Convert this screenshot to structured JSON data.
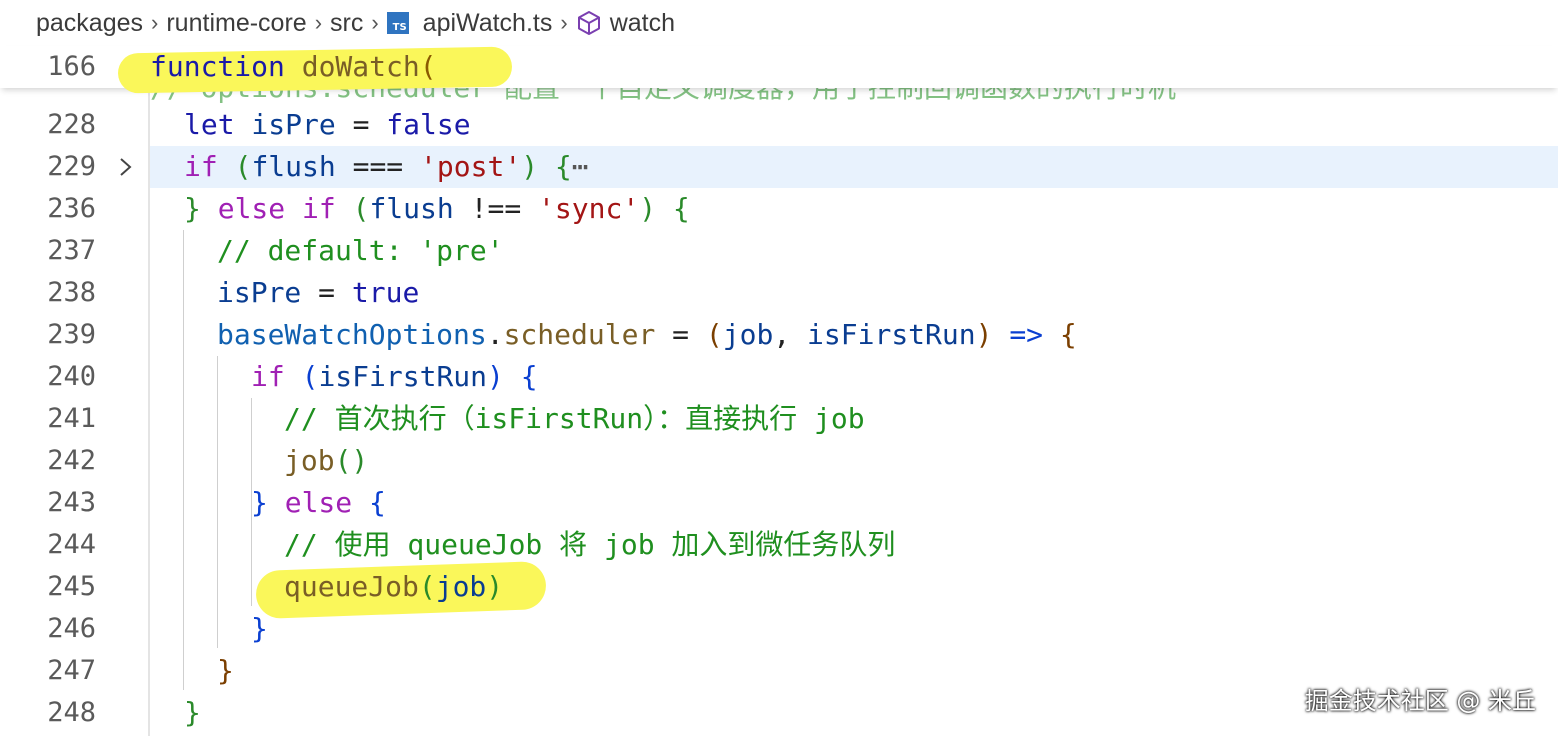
{
  "breadcrumb": {
    "items": [
      "packages",
      "runtime-core",
      "src",
      "apiWatch.ts",
      "watch"
    ],
    "file_icon_text": "TS"
  },
  "editor": {
    "sticky_line": {
      "number": "166",
      "text": "function doWatch("
    },
    "hidden_line_text": "// options.scheduler 配置一个自定义调度器，用于控制回调函数的执行时机",
    "lines": [
      {
        "number": "228",
        "t1": "let",
        "t2": " isPre ",
        "t3": "=",
        "t4": " false"
      },
      {
        "number": "229",
        "t1": "if",
        "t2": " (",
        "t3": "flush",
        "t4": " === ",
        "t5": "'post'",
        "t6": ") ",
        "t7": "{",
        "t8": "⋯"
      },
      {
        "number": "236",
        "t1": "} ",
        "t2": "else if",
        "t3": " (",
        "t4": "flush",
        "t5": " !== ",
        "t6": "'sync'",
        "t7": ") {"
      },
      {
        "number": "237",
        "t1": "// default: 'pre'"
      },
      {
        "number": "238",
        "t1": "isPre",
        "t2": " = ",
        "t3": "true"
      },
      {
        "number": "239",
        "t1": "baseWatchOptions",
        "t2": ".",
        "t3": "scheduler",
        "t4": " = ",
        "t5": "(",
        "t6": "job",
        "t7": ", ",
        "t8": "isFirstRun",
        "t9": ")",
        "t10": " => ",
        "t11": "{"
      },
      {
        "number": "240",
        "t1": "if",
        "t2": " (",
        "t3": "isFirstRun",
        "t4": ") {"
      },
      {
        "number": "241",
        "t1": "// 首次执行（isFirstRun）：直接执行 job"
      },
      {
        "number": "242",
        "t1": "job",
        "t2": "()"
      },
      {
        "number": "243",
        "t1": "} ",
        "t2": "else",
        "t3": " {"
      },
      {
        "number": "244",
        "t1": "// 使用 queueJob 将 job 加入到微任务队列"
      },
      {
        "number": "245",
        "t1": "queueJob",
        "t2": "(",
        "t3": "job",
        "t4": ")"
      },
      {
        "number": "246",
        "t1": "}"
      },
      {
        "number": "247",
        "t1": "}"
      },
      {
        "number": "248",
        "t1": "}"
      }
    ]
  },
  "watermark": "掘金技术社区 @ 米丘",
  "colors": {
    "highlight": "#faf75a",
    "cursor_line": "#e8f2fd",
    "keyword": "#a020b4",
    "string": "#a31515",
    "comment": "#1f8f1f"
  }
}
